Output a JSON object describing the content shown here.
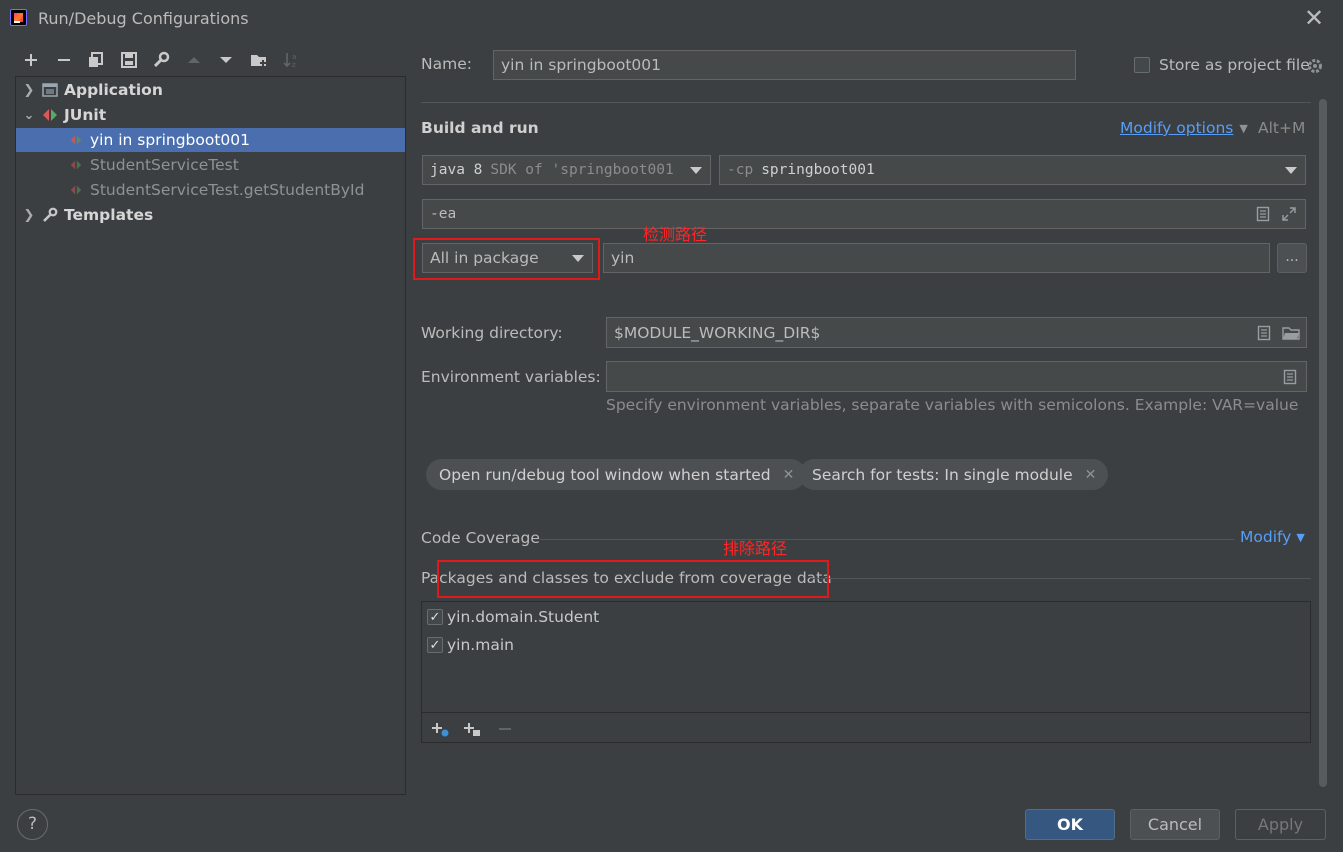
{
  "window": {
    "title": "Run/Debug Configurations"
  },
  "tree": {
    "items": [
      {
        "label": "Application"
      },
      {
        "label": "JUnit"
      },
      {
        "label": "yin in springboot001"
      },
      {
        "label": "StudentServiceTest"
      },
      {
        "label": "StudentServiceTest.getStudentById"
      },
      {
        "label": "Templates"
      }
    ]
  },
  "form": {
    "name_label": "Name:",
    "name_value": "yin in springboot001",
    "store_label": "Store as project file",
    "build_run_label": "Build and run",
    "modify_options": "Modify options",
    "modify_shortcut": "Alt+M",
    "jdk_value_prefix": "java 8",
    "jdk_value_rest": "SDK of 'springboot001",
    "cp_flag": "-cp",
    "cp_value": "springboot001",
    "vm_options": "-ea",
    "test_kind": "All in package",
    "package_value": "yin",
    "browse_label": "...",
    "workdir_label": "Working directory:",
    "workdir_value": "$MODULE_WORKING_DIR$",
    "env_label": "Environment variables:",
    "env_hint": "Specify environment variables, separate variables with semicolons. Example: VAR=value",
    "chips": [
      {
        "label": "Open run/debug tool window when started"
      },
      {
        "label": "Search for tests: In single module"
      }
    ],
    "coverage_label": "Code Coverage",
    "coverage_modify": "Modify",
    "exclude_label": "Packages and classes to exclude from coverage data",
    "exclude_items": [
      {
        "label": "yin.domain.Student",
        "checked": true
      },
      {
        "label": "yin.main",
        "checked": true
      }
    ]
  },
  "annotations": {
    "detect_path": "检测路径",
    "exclude_path": "排除路径"
  },
  "buttons": {
    "help": "?",
    "ok": "OK",
    "cancel": "Cancel",
    "apply": "Apply"
  }
}
